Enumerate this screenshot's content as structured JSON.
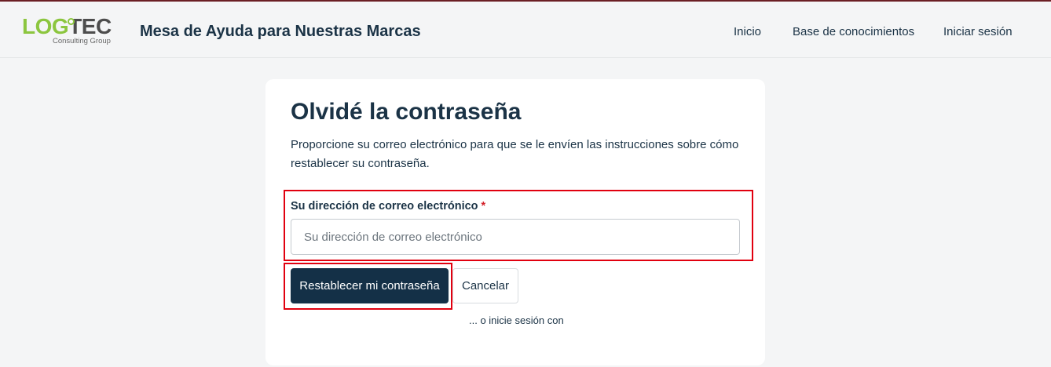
{
  "brand": {
    "logo_main_left": "LOG",
    "logo_main_right": "TEC",
    "logo_sub": "Consulting Group",
    "logo_color_primary": "#8cc63f",
    "logo_color_secondary": "#4d4d4d"
  },
  "header": {
    "title": "Mesa de Ayuda para Nuestras Marcas",
    "nav": [
      {
        "label": "Inicio"
      },
      {
        "label": "Base de conocimientos"
      },
      {
        "label": "Iniciar sesión"
      }
    ]
  },
  "form": {
    "title": "Olvidé la contraseña",
    "description": "Proporcione su correo electrónico para que se le envíen las instrucciones sobre cómo restablecer su contraseña.",
    "email_label": "Su dirección de correo electrónico",
    "required_mark": "*",
    "email_placeholder": "Su dirección de correo electrónico",
    "email_value": "",
    "submit_label": "Restablecer mi contraseña",
    "cancel_label": "Cancelar",
    "alt_login_text": "... o inicie sesión con"
  },
  "colors": {
    "accent": "#143047",
    "highlight": "#e1000f",
    "required": "#d3222a"
  }
}
